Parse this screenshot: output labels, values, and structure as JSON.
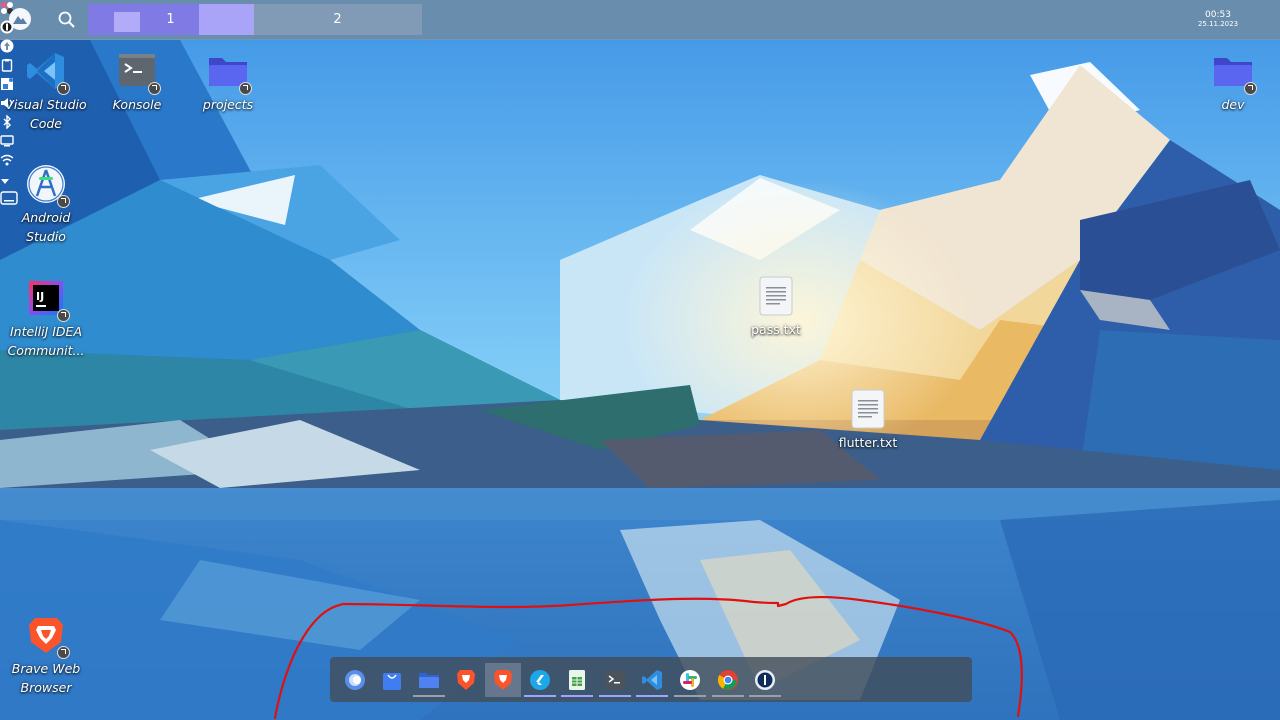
{
  "panel": {
    "pager": {
      "desktops": [
        "1",
        "2"
      ]
    },
    "clock": {
      "time": "00:53",
      "date": "25.11.2023"
    },
    "tray_icons": [
      "pinwheel-icon",
      "password-manager-icon",
      "updates-icon",
      "clipboard-icon",
      "notes-icon",
      "volume-icon",
      "bluetooth-icon",
      "display-icon",
      "wifi-icon",
      "expand-tray-icon"
    ]
  },
  "desktop": {
    "icons": [
      {
        "label": "Visual Studio Code",
        "icon": "vscode-icon"
      },
      {
        "label": "Konsole",
        "icon": "terminal-icon"
      },
      {
        "label": "projects",
        "icon": "folder-icon"
      },
      {
        "label": "dev",
        "icon": "folder-icon"
      },
      {
        "label": "Android Studio",
        "icon": "android-studio-icon"
      },
      {
        "label": "IntelliJ IDEA Communit...",
        "icon": "intellij-icon"
      },
      {
        "label": "pass.txt",
        "icon": "text-file-icon"
      },
      {
        "label": "flutter.txt",
        "icon": "text-file-icon"
      },
      {
        "label": "Brave Web Browser",
        "icon": "brave-icon"
      }
    ]
  },
  "dock": {
    "items": [
      {
        "name": "toggle-icon"
      },
      {
        "name": "store-icon"
      },
      {
        "name": "folder-icon"
      },
      {
        "name": "brave-icon"
      },
      {
        "name": "brave-icon"
      },
      {
        "name": "flutter-icon"
      },
      {
        "name": "spreadsheet-icon"
      },
      {
        "name": "terminal-icon"
      },
      {
        "name": "vscode-icon"
      },
      {
        "name": "slack-icon"
      },
      {
        "name": "chrome-icon"
      },
      {
        "name": "password-manager-icon"
      }
    ]
  },
  "colors": {
    "panel": "#6c8ca8",
    "pager_active": "#8076ec",
    "dock": "#424e5c",
    "annotation": "#e01010",
    "folder": "#5b66f0"
  }
}
